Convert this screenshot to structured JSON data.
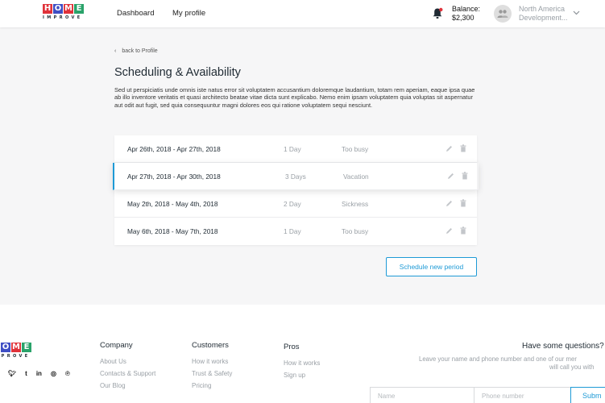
{
  "header": {
    "logo_letters": [
      "H",
      "O",
      "M",
      "E"
    ],
    "logo_colors": [
      "#e0323a",
      "#3f4ec4",
      "#e0323a",
      "#2aa36a"
    ],
    "logo_subtitle": "IMPROVE",
    "nav": [
      "Dashboard",
      "My profile"
    ],
    "balance_label": "Balance:",
    "balance_value": "$2,300",
    "region_line1": "North America",
    "region_line2": "Development..."
  },
  "main": {
    "back_label": "back to Profile",
    "title": "Scheduling & Availability",
    "description": "Sed ut perspiciatis unde omnis iste natus error sit voluptatem accusantium doloremque laudantium, totam rem aperiam, eaque ipsa quae ab illo inventore veritatis et quasi architecto beatae vitae dicta sunt explicabo. Nemo enim ipsam voluptatem quia voluptas sit aspernatur aut odit aut fugit, sed quia consequuntur magni dolores eos qui ratione voluptatem sequi nesciunt.",
    "periods": [
      {
        "dates": "Apr 26th, 2018 - Apr 27th, 2018",
        "length": "1 Day",
        "reason": "Too busy"
      },
      {
        "dates": "Apr 27th, 2018 - Apr 30th, 2018",
        "length": "3 Days",
        "reason": "Vacation"
      },
      {
        "dates": "May 2th, 2018 - May 4th, 2018",
        "length": "2 Day",
        "reason": "Sickness"
      },
      {
        "dates": "May 6th, 2018 - May 7th, 2018",
        "length": "1 Day",
        "reason": "Too busy"
      }
    ],
    "schedule_button": "Schedule new period",
    "accent_color": "#1e9ad6"
  },
  "footer": {
    "company": {
      "heading": "Company",
      "links": [
        "About Us",
        "Contacts & Support",
        "Our Blog"
      ]
    },
    "customers": {
      "heading": "Customers",
      "links": [
        "How it works",
        "Trust & Safety",
        "Pricing"
      ]
    },
    "pros": {
      "heading": "Pros",
      "links": [
        "How it works",
        "Sign up"
      ]
    },
    "social_icons": [
      "twitter-icon",
      "tumblr-icon",
      "linkedin-icon",
      "instagram-icon",
      "pinterest-icon"
    ],
    "contact_title": "Have some questions? A",
    "contact_sub1": "Leave your name and phone number and one of our mer",
    "contact_sub2": "will call you with",
    "name_placeholder": "Name",
    "phone_placeholder": "Phone number",
    "submit_label": "Subm"
  }
}
